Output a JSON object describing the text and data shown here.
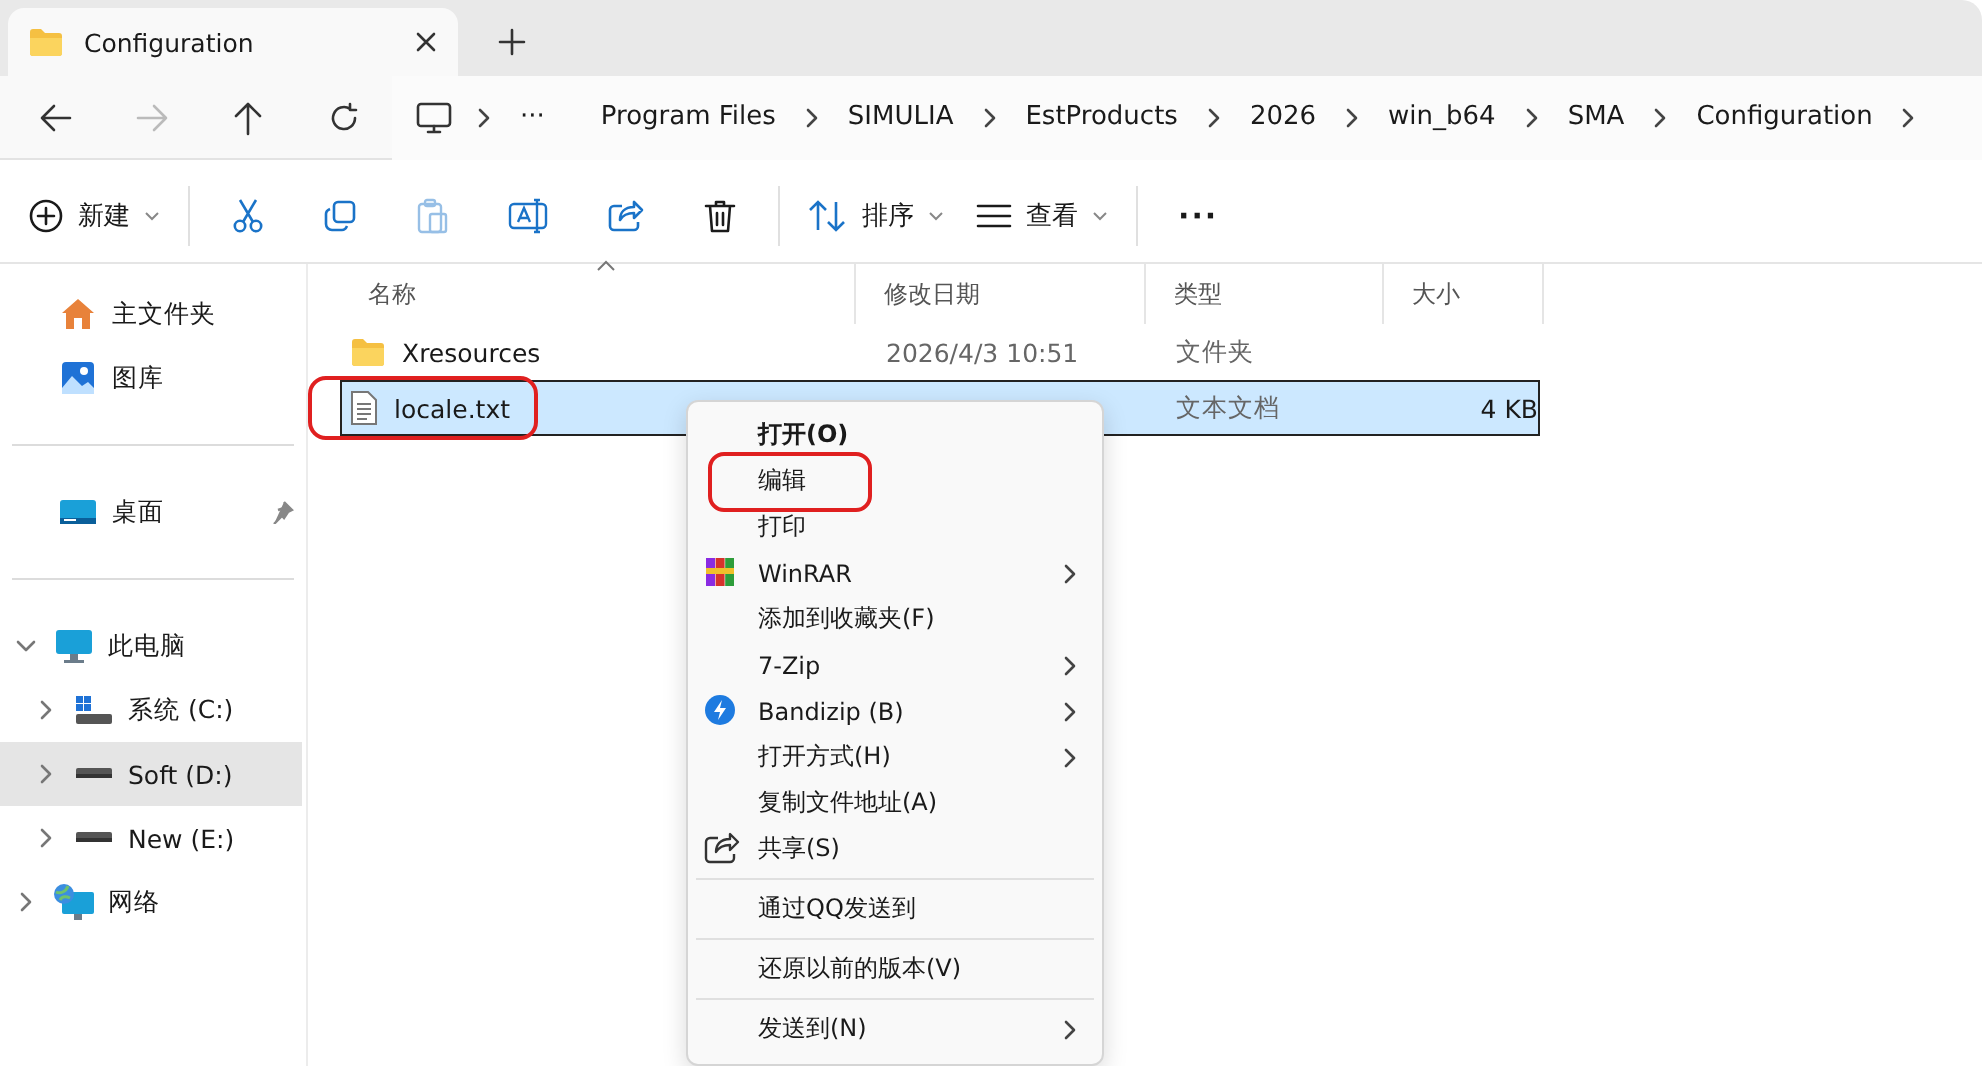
{
  "tab": {
    "title": "Configuration"
  },
  "nav": [
    {
      "kind": "back",
      "disabled": false
    },
    {
      "kind": "forward",
      "disabled": true
    },
    {
      "kind": "up",
      "disabled": false
    },
    {
      "kind": "refresh",
      "disabled": false
    }
  ],
  "breadcrumb": {
    "overflow": "···",
    "items": [
      "Program Files",
      "SIMULIA",
      "EstProducts",
      "2026",
      "win_b64",
      "SMA",
      "Configuration"
    ]
  },
  "toolbar": {
    "groups": [
      [
        {
          "kind": "new",
          "label": "新建",
          "disabled": false
        }
      ],
      [
        {
          "kind": "cut",
          "disabled": false
        },
        {
          "kind": "copy",
          "disabled": false
        },
        {
          "kind": "paste",
          "disabled": true
        },
        {
          "kind": "rename",
          "disabled": false
        },
        {
          "kind": "share",
          "disabled": false
        },
        {
          "kind": "delete",
          "disabled": false
        }
      ],
      [
        {
          "kind": "sort",
          "label": "排序",
          "disabled": false
        },
        {
          "kind": "view",
          "label": "查看",
          "disabled": false
        }
      ],
      [
        {
          "kind": "more",
          "label": "···",
          "disabled": false
        }
      ]
    ]
  },
  "sidebar": {
    "sections": [
      [
        {
          "kind": "home",
          "label": "主文件夹",
          "pinned": false,
          "selected": false
        },
        {
          "kind": "gallery",
          "label": "图库",
          "pinned": false,
          "selected": false
        }
      ],
      [
        {
          "kind": "desktop",
          "label": "桌面",
          "pinned": true,
          "selected": false
        }
      ],
      [
        {
          "kind": "pc",
          "label": "此电脑",
          "expanded": true,
          "selected": false,
          "children": [
            {
              "kind": "system-drive",
              "label": "系统 (C:)",
              "expanded": false,
              "selected": false
            },
            {
              "kind": "drive",
              "label": "Soft (D:)",
              "expanded": false,
              "selected": true
            },
            {
              "kind": "drive",
              "label": "New (E:)",
              "expanded": false,
              "selected": false
            }
          ]
        },
        {
          "kind": "network",
          "label": "网络",
          "expanded": false,
          "selected": false
        }
      ]
    ]
  },
  "table": {
    "columns": [
      {
        "label": "名称",
        "sorted": true
      },
      {
        "label": "修改日期",
        "sorted": false
      },
      {
        "label": "类型",
        "sorted": false
      },
      {
        "label": "大小",
        "sorted": false
      }
    ],
    "rows": [
      {
        "kind": "folder",
        "name": "Xresources",
        "date": "2026/4/3 10:51",
        "type": "文件夹",
        "selected": false,
        "highlighted": false
      },
      {
        "kind": "text",
        "name": "locale.txt",
        "type": "文本文档",
        "size": "4 KB",
        "selected": true,
        "highlighted": true
      }
    ]
  },
  "context_menu": {
    "items": [
      {
        "kind": "plain",
        "label": "打开(O)",
        "default": true,
        "submenu": false,
        "separator_before": false,
        "highlighted": false
      },
      {
        "kind": "plain",
        "label": "编辑",
        "default": false,
        "submenu": false,
        "separator_before": false,
        "highlighted": true
      },
      {
        "kind": "plain",
        "label": "打印",
        "default": false,
        "submenu": false,
        "separator_before": false,
        "highlighted": false
      },
      {
        "kind": "winrar",
        "label": "WinRAR",
        "default": false,
        "submenu": true,
        "separator_before": false,
        "highlighted": false
      },
      {
        "kind": "plain",
        "label": "添加到收藏夹(F)",
        "default": false,
        "submenu": false,
        "separator_before": false,
        "highlighted": false
      },
      {
        "kind": "plain",
        "label": "7-Zip",
        "default": false,
        "submenu": true,
        "separator_before": false,
        "highlighted": false
      },
      {
        "kind": "bandizip",
        "label": "Bandizip (B)",
        "default": false,
        "submenu": true,
        "separator_before": false,
        "highlighted": false
      },
      {
        "kind": "plain",
        "label": "打开方式(H)",
        "default": false,
        "submenu": true,
        "separator_before": false,
        "highlighted": false
      },
      {
        "kind": "plain",
        "label": "复制文件地址(A)",
        "default": false,
        "submenu": false,
        "separator_before": false,
        "highlighted": false
      },
      {
        "kind": "share",
        "label": "共享(S)",
        "default": false,
        "submenu": false,
        "separator_before": false,
        "highlighted": false
      },
      {
        "kind": "plain",
        "label": "通过QQ发送到",
        "default": false,
        "submenu": false,
        "separator_before": true,
        "highlighted": false
      },
      {
        "kind": "plain",
        "label": "还原以前的版本(V)",
        "default": false,
        "submenu": false,
        "separator_before": true,
        "highlighted": false
      },
      {
        "kind": "plain",
        "label": "发送到(N)",
        "default": false,
        "submenu": true,
        "separator_before": true,
        "highlighted": false
      }
    ]
  }
}
